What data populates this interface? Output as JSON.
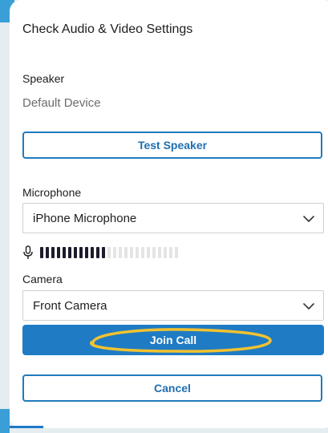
{
  "dialog": {
    "title": "Check Audio & Video Settings"
  },
  "speaker": {
    "label": "Speaker",
    "device": "Default Device",
    "test_button": "Test Speaker"
  },
  "microphone": {
    "label": "Microphone",
    "selected": "iPhone Microphone",
    "level_fraction": 0.48,
    "level_bar_count": 25,
    "level_active_color": "#1c1c2c",
    "level_inactive_color": "#e4e4e4"
  },
  "camera": {
    "label": "Camera",
    "selected": "Front Camera"
  },
  "actions": {
    "join_label": "Join Call",
    "cancel_label": "Cancel"
  },
  "colors": {
    "accent": "#1f7bc4",
    "highlight": "#f2c230",
    "background": "#e5edf1"
  },
  "icons": {
    "microphone": "microphone-icon",
    "dropdown": "chevron-down-icon"
  }
}
